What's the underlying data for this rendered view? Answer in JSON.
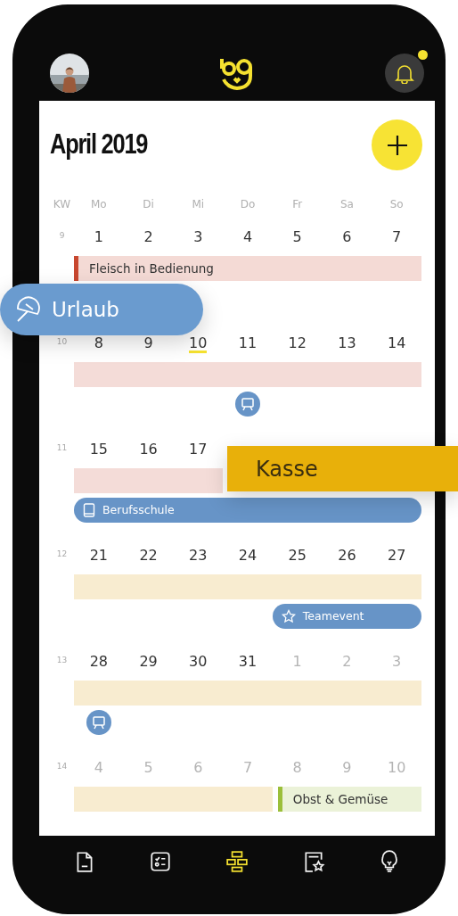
{
  "header": {
    "notifications": {
      "unread": true
    }
  },
  "title": "April 2019",
  "weekday_header": [
    "KW",
    "Mo",
    "Di",
    "Mi",
    "Do",
    "Fr",
    "Sa",
    "So"
  ],
  "weeks": [
    {
      "kw": "9",
      "days": [
        {
          "label": "1",
          "muted": false,
          "today": false
        },
        {
          "label": "2",
          "muted": false,
          "today": false
        },
        {
          "label": "3",
          "muted": false,
          "today": false
        },
        {
          "label": "4",
          "muted": false,
          "today": false
        },
        {
          "label": "5",
          "muted": false,
          "today": false
        },
        {
          "label": "6",
          "muted": false,
          "today": false
        },
        {
          "label": "7",
          "muted": false,
          "today": false
        }
      ],
      "lanes": [
        [
          {
            "kind": "bar",
            "color": "#c8472f",
            "edge": true,
            "label": "Fleisch in Bedienung"
          },
          {
            "kind": "continued"
          },
          {
            "kind": "continued"
          },
          {
            "kind": "continued"
          },
          {
            "kind": "continued"
          },
          {
            "kind": "continued"
          },
          {
            "kind": "continued"
          }
        ]
      ]
    },
    {
      "kw": "10",
      "days": [
        {
          "label": "8",
          "muted": false,
          "today": false
        },
        {
          "label": "9",
          "muted": false,
          "today": false
        },
        {
          "label": "10",
          "muted": false,
          "today": true
        },
        {
          "label": "11",
          "muted": false,
          "today": false
        },
        {
          "label": "12",
          "muted": false,
          "today": false
        },
        {
          "label": "13",
          "muted": false,
          "today": false
        },
        {
          "label": "14",
          "muted": false,
          "today": false
        }
      ],
      "lanes": [
        [
          {
            "kind": "bar",
            "color": "#f4dcd8",
            "edge": false
          },
          {
            "kind": "continued"
          },
          {
            "kind": "continued"
          },
          {
            "kind": "continued"
          },
          {
            "kind": "continued"
          },
          {
            "kind": "continued"
          },
          {
            "kind": "continued"
          }
        ],
        [
          {
            "kind": "empty"
          },
          {
            "kind": "empty"
          },
          {
            "kind": "empty"
          },
          {
            "kind": "presentation"
          }
        ]
      ]
    },
    {
      "kw": "11",
      "days": [
        {
          "label": "15",
          "muted": false,
          "today": false
        },
        {
          "label": "16",
          "muted": false,
          "today": false
        },
        {
          "label": "17",
          "muted": false,
          "today": false
        }
      ],
      "lanes": [
        [
          {
            "kind": "bar",
            "color": "#f4dcd8",
            "edge": false
          },
          {
            "kind": "continued"
          },
          {
            "kind": "continued"
          }
        ],
        [
          {
            "kind": "course",
            "label": "Berufsschule"
          },
          {
            "kind": "continued"
          },
          {
            "kind": "continued"
          },
          {
            "kind": "continued"
          },
          {
            "kind": "continued"
          },
          {
            "kind": "continued"
          },
          {
            "kind": "continued"
          }
        ]
      ]
    },
    {
      "kw": "12",
      "days": [
        {
          "label": "21",
          "muted": false,
          "today": false
        },
        {
          "label": "22",
          "muted": false,
          "today": false
        },
        {
          "label": "23",
          "muted": false,
          "today": false
        },
        {
          "label": "24",
          "muted": false,
          "today": false
        },
        {
          "label": "25",
          "muted": false,
          "today": false
        },
        {
          "label": "26",
          "muted": false,
          "today": false
        },
        {
          "label": "27",
          "muted": false,
          "today": false
        }
      ],
      "lanes": [
        [
          {
            "kind": "bar",
            "color": "#f8ecd0",
            "edge": false
          },
          {
            "kind": "continued"
          },
          {
            "kind": "continued"
          },
          {
            "kind": "continued"
          },
          {
            "kind": "continued"
          },
          {
            "kind": "continued"
          },
          {
            "kind": "continued"
          }
        ],
        [
          {
            "kind": "empty"
          },
          {
            "kind": "empty"
          },
          {
            "kind": "empty"
          },
          {
            "kind": "empty"
          },
          {
            "kind": "event",
            "label": "Teamevent"
          },
          {
            "kind": "continued"
          },
          {
            "kind": "continued"
          }
        ]
      ]
    },
    {
      "kw": "13",
      "days": [
        {
          "label": "28",
          "muted": false,
          "today": false
        },
        {
          "label": "29",
          "muted": false,
          "today": false
        },
        {
          "label": "30",
          "muted": false,
          "today": false
        },
        {
          "label": "31",
          "muted": false,
          "today": false
        },
        {
          "label": "1",
          "muted": true,
          "today": false
        },
        {
          "label": "2",
          "muted": true,
          "today": false
        },
        {
          "label": "3",
          "muted": true,
          "today": false
        }
      ],
      "lanes": [
        [
          {
            "kind": "bar",
            "color": "#f8ecd0",
            "edge": false
          },
          {
            "kind": "continued"
          },
          {
            "kind": "continued"
          },
          {
            "kind": "continued"
          },
          {
            "kind": "continued"
          },
          {
            "kind": "continued"
          },
          {
            "kind": "continued"
          }
        ],
        [
          {
            "kind": "presentation"
          }
        ]
      ]
    },
    {
      "kw": "14",
      "days": [
        {
          "label": "4",
          "muted": true,
          "today": false
        },
        {
          "label": "5",
          "muted": true,
          "today": false
        },
        {
          "label": "6",
          "muted": true,
          "today": false
        },
        {
          "label": "7",
          "muted": true,
          "today": false
        },
        {
          "label": "8",
          "muted": true,
          "today": false
        },
        {
          "label": "9",
          "muted": true,
          "today": false
        },
        {
          "label": "10",
          "muted": true,
          "today": false
        }
      ],
      "lanes": [
        [
          {
            "kind": "bar",
            "color": "#f8ecd0",
            "edge": false
          },
          {
            "kind": "continued"
          },
          {
            "kind": "continued"
          },
          {
            "kind": "continued"
          },
          {
            "kind": "bar",
            "color": "#9bbf3a",
            "edge": true,
            "label": "Obst & Gemüse"
          },
          {
            "kind": "continued"
          },
          {
            "kind": "continued"
          }
        ]
      ]
    }
  ],
  "floating_labels": [
    {
      "kind": "vacation",
      "label": "Urlaub"
    },
    {
      "kind": "shift",
      "label": "Kasse"
    }
  ],
  "nav": [
    {
      "kind": "document",
      "selected": false
    },
    {
      "kind": "checklist",
      "selected": false
    },
    {
      "kind": "schedule",
      "selected": true
    },
    {
      "kind": "favorites",
      "selected": false
    },
    {
      "kind": "ideas",
      "selected": false
    }
  ]
}
